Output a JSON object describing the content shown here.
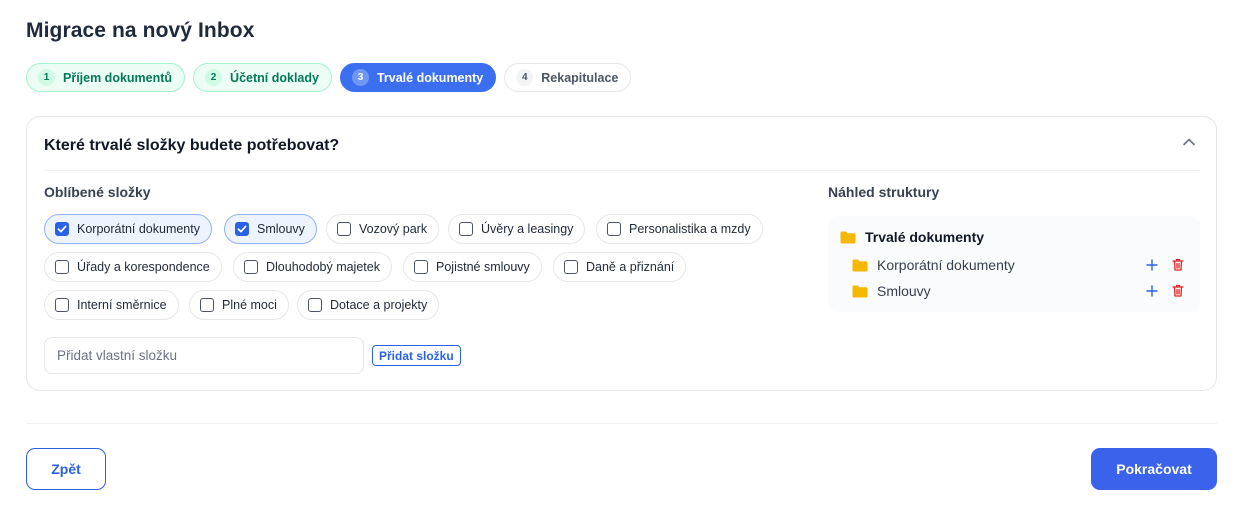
{
  "page": {
    "title": "Migrace na nový Inbox"
  },
  "steps": [
    {
      "number": "1",
      "label": "Příjem dokumentů",
      "state": "done"
    },
    {
      "number": "2",
      "label": "Účetní doklady",
      "state": "done"
    },
    {
      "number": "3",
      "label": "Trvalé dokumenty",
      "state": "active"
    },
    {
      "number": "4",
      "label": "Rekapitulace",
      "state": "todo"
    }
  ],
  "card": {
    "title": "Které trvalé složky budete potřebovat?",
    "favorites_label": "Oblíbené složky",
    "chips": [
      {
        "label": "Korporátní dokumenty",
        "checked": true
      },
      {
        "label": "Smlouvy",
        "checked": true
      },
      {
        "label": "Vozový park",
        "checked": false
      },
      {
        "label": "Úvěry a leasingy",
        "checked": false
      },
      {
        "label": "Personalistika a mzdy",
        "checked": false
      },
      {
        "label": "Úřady a korespondence",
        "checked": false
      },
      {
        "label": "Dlouhodobý majetek",
        "checked": false
      },
      {
        "label": "Pojistné smlouvy",
        "checked": false
      },
      {
        "label": "Daně a přiznání",
        "checked": false
      },
      {
        "label": "Interní směrnice",
        "checked": false
      },
      {
        "label": "Plné moci",
        "checked": false
      },
      {
        "label": "Dotace a projekty",
        "checked": false
      }
    ],
    "custom_folder": {
      "placeholder": "Přidat vlastní složku",
      "value": "",
      "button_label": "Přidat složku"
    }
  },
  "preview": {
    "label": "Náhled struktury",
    "root": "Trvalé dokumenty",
    "children": [
      "Korporátní dokumenty",
      "Smlouvy"
    ]
  },
  "footer": {
    "back_label": "Zpět",
    "next_label": "Pokračovat"
  },
  "colors": {
    "accent": "#3b62ea",
    "done": "#047857",
    "folder": "#f5b800",
    "delete": "#dc2626"
  },
  "icons": {
    "collapse": "chevron-up-icon",
    "folder": "folder-icon",
    "add": "plus-icon",
    "delete": "trash-icon",
    "checkbox": "checkmark-icon"
  }
}
